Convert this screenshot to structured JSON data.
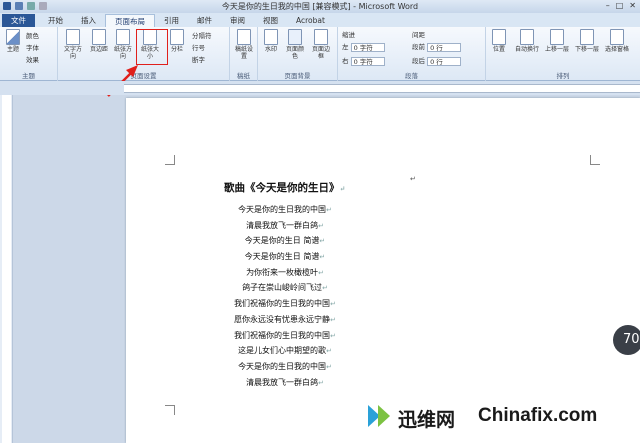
{
  "window": {
    "title": "今天是你的生日我的中国 [兼容模式] - Microsoft Word"
  },
  "tabs": [
    "文件",
    "开始",
    "插入",
    "页面布局",
    "引用",
    "邮件",
    "审阅",
    "视图",
    "Acrobat"
  ],
  "ribbon": {
    "themes": {
      "btn": "主题",
      "colors": "颜色",
      "fonts": "字体",
      "effects": "效果",
      "label": "主题"
    },
    "page_setup": {
      "text_dir": "文字方向",
      "margins": "页边距",
      "orientation": "纸张方向",
      "size": "纸张大小",
      "columns": "分栏",
      "breaks": "分隔符",
      "line_numbers": "行号",
      "hyphenation": "断字",
      "label": "页面设置"
    },
    "manuscript": {
      "btn": "稿纸设置",
      "label": "稿纸"
    },
    "background": {
      "watermark": "水印",
      "page_color": "页面颜色",
      "page_border": "页面边框",
      "label": "页面背景"
    },
    "paragraph": {
      "indent": "缩进",
      "left": "左",
      "right": "右",
      "left_val": "0 字符",
      "right_val": "0 字符",
      "spacing": "间距",
      "before": "段前",
      "after": "段后",
      "before_val": "0 行",
      "after_val": "0 行",
      "label": "段落"
    },
    "arrange": {
      "position": "位置",
      "wrap": "自动换行",
      "forward": "上移一层",
      "backward": "下移一层",
      "pane": "选择窗格",
      "label": "排列"
    }
  },
  "document": {
    "title": "歌曲《今天是你的生日》",
    "lines": [
      "今天是你的生日我的中国",
      "清晨我放飞一群白鸽",
      "今天是你的生日 简谱",
      "今天是你的生日 简谱",
      "为你衔来一枚橄榄叶",
      "鸽子在崇山峻岭间飞过",
      "我们祝福你的生日我的中国",
      "愿你永远没有忧患永远宁静",
      "我们祝福你的生日我的中国",
      "这是儿女们心中期望的歌",
      "今天是你的生日我的中国",
      "清晨我放飞一群白鸽"
    ]
  },
  "overlay": {
    "badge": "70",
    "watermark_cn": "迅维网",
    "watermark_en": "Chinafix.com"
  },
  "colors": {
    "highlight": "#e0201c",
    "file_tab": "#2b5797"
  }
}
